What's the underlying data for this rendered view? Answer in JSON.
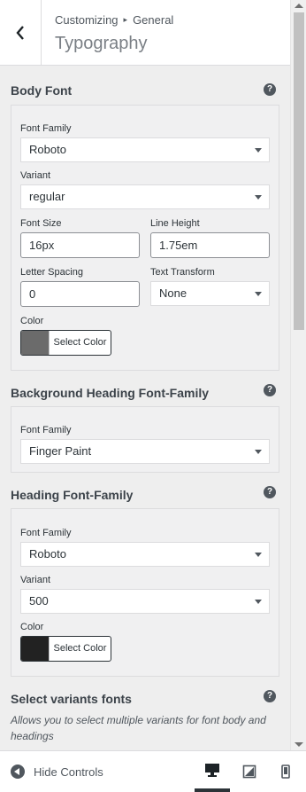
{
  "header": {
    "breadcrumb_root": "Customizing",
    "breadcrumb_sep": "▸",
    "breadcrumb_section": "General",
    "title": "Typography"
  },
  "body_font": {
    "title": "Body Font",
    "help": "?",
    "font_family_label": "Font Family",
    "font_family_value": "Roboto",
    "variant_label": "Variant",
    "variant_value": "regular",
    "font_size_label": "Font Size",
    "font_size_value": "16px",
    "line_height_label": "Line Height",
    "line_height_value": "1.75em",
    "letter_spacing_label": "Letter Spacing",
    "letter_spacing_value": "0",
    "text_transform_label": "Text Transform",
    "text_transform_value": "None",
    "color_label": "Color",
    "color_button": "Select Color",
    "color_value": "#6b6b6b"
  },
  "background_heading": {
    "title": "Background Heading Font-Family",
    "help": "?",
    "font_family_label": "Font Family",
    "font_family_value": "Finger Paint"
  },
  "heading_font": {
    "title": "Heading Font-Family",
    "help": "?",
    "font_family_label": "Font Family",
    "font_family_value": "Roboto",
    "variant_label": "Variant",
    "variant_value": "500",
    "color_label": "Color",
    "color_button": "Select Color",
    "color_value": "#222222"
  },
  "variants_fonts": {
    "title": "Select variants fonts",
    "help": "?",
    "description": "Allows you to select multiple variants for font body and headings"
  },
  "footer": {
    "hide_controls": "Hide Controls"
  }
}
